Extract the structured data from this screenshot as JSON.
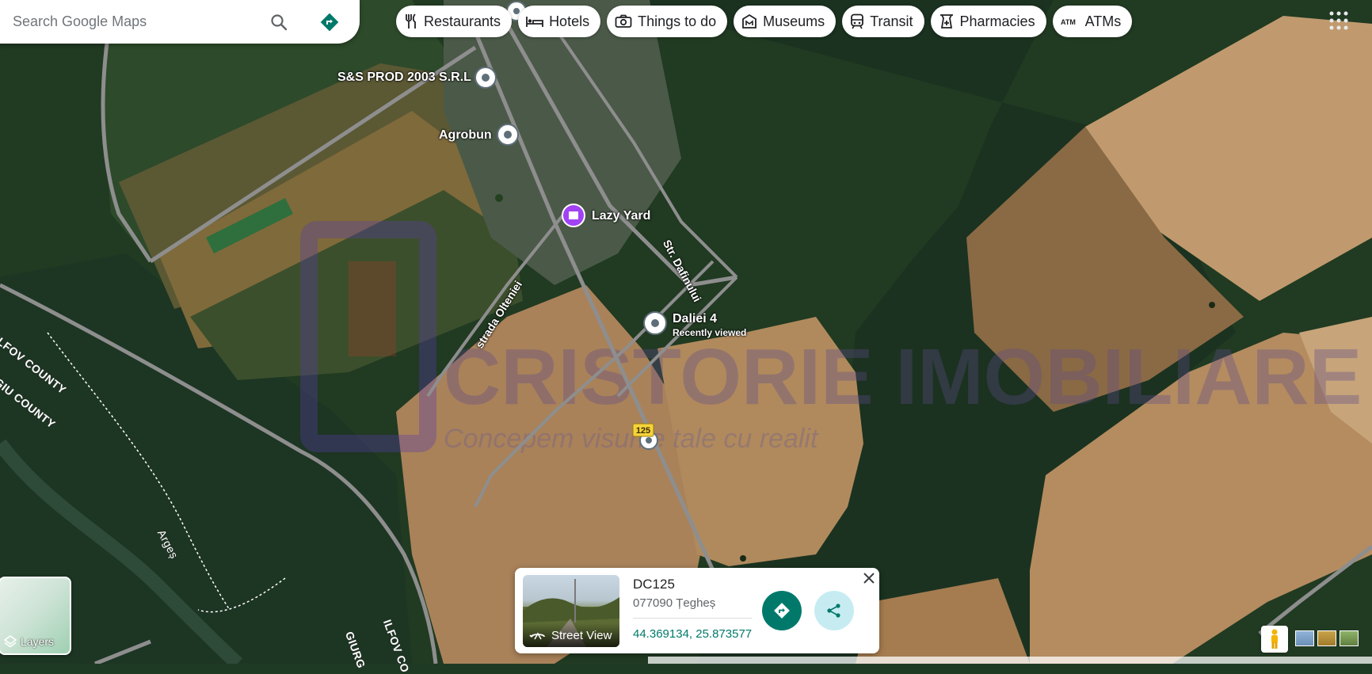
{
  "search": {
    "placeholder": "Search Google Maps"
  },
  "chips": [
    {
      "label": "Restaurants",
      "icon": "fork-knife-icon"
    },
    {
      "label": "Hotels",
      "icon": "bed-icon"
    },
    {
      "label": "Things to do",
      "icon": "camera-icon"
    },
    {
      "label": "Museums",
      "icon": "museum-icon"
    },
    {
      "label": "Transit",
      "icon": "train-icon"
    },
    {
      "label": "Pharmacies",
      "icon": "pharmacy-icon"
    },
    {
      "label": "ATMs",
      "icon": "atm-icon"
    }
  ],
  "places": [
    {
      "name": "S&S PROD 2003 S.R.L"
    },
    {
      "name": "Agrobun"
    },
    {
      "name": "Lazy Yard"
    },
    {
      "name": "Daliei 4",
      "sub": "Recently viewed"
    }
  ],
  "roads": {
    "dafinului": "Str. Dafinului",
    "olteniei": "strada Olteniei",
    "marker": "125"
  },
  "regions": {
    "ilfov1": "ILFOV COUNTY",
    "giurgiu1": "GIU COUNTY",
    "river": "Argeș",
    "giurgiu2": "GIURG",
    "ilfov2": "ILFOV CO"
  },
  "watermark": {
    "title": "CRISTORIE IMOBILIARE",
    "tagline": "Concepem visurile tale cu realit"
  },
  "card": {
    "title": "DC125",
    "address": "077090 Țegheș",
    "coords": "44.369134, 25.873577",
    "street_view": "Street View"
  },
  "layers": {
    "label": "Layers"
  },
  "colors": {
    "accent": "#00796b",
    "share_bg": "#c6ecf2",
    "poi_purple": "#a142f4"
  }
}
